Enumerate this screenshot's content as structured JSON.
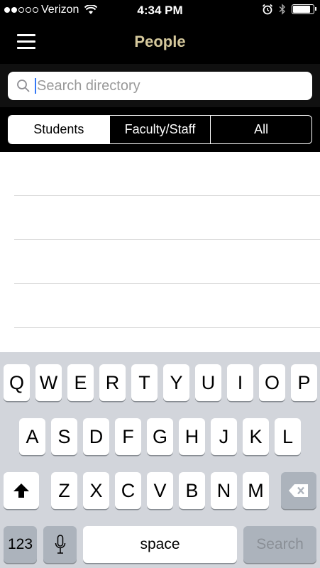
{
  "status_bar": {
    "signal_strength": 2,
    "carrier": "Verizon",
    "time": "4:34 PM",
    "battery_level": 0.85,
    "icons": [
      "wifi-icon",
      "alarm-icon",
      "bluetooth-icon",
      "battery-icon"
    ]
  },
  "nav": {
    "title": "People",
    "menu_icon": "hamburger-menu-icon"
  },
  "search": {
    "placeholder": "Search directory",
    "value": ""
  },
  "segments": [
    {
      "label": "Students",
      "selected": true
    },
    {
      "label": "Faculty/Staff",
      "selected": false
    },
    {
      "label": "All",
      "selected": false
    }
  ],
  "keyboard": {
    "row1": [
      "Q",
      "W",
      "E",
      "R",
      "T",
      "Y",
      "U",
      "I",
      "O",
      "P"
    ],
    "row2": [
      "A",
      "S",
      "D",
      "F",
      "G",
      "H",
      "J",
      "K",
      "L"
    ],
    "row3": [
      "Z",
      "X",
      "C",
      "V",
      "B",
      "N",
      "M"
    ],
    "numbers_label": "123",
    "space_label": "space",
    "return_label": "Search",
    "shift_icon": "shift-icon",
    "delete_icon": "backspace-icon",
    "mic_icon": "microphone-icon"
  },
  "colors": {
    "title_accent": "#d5c89c",
    "nav_bg": "#000000",
    "keyboard_bg": "#d2d5db",
    "caret": "#3478f6"
  }
}
